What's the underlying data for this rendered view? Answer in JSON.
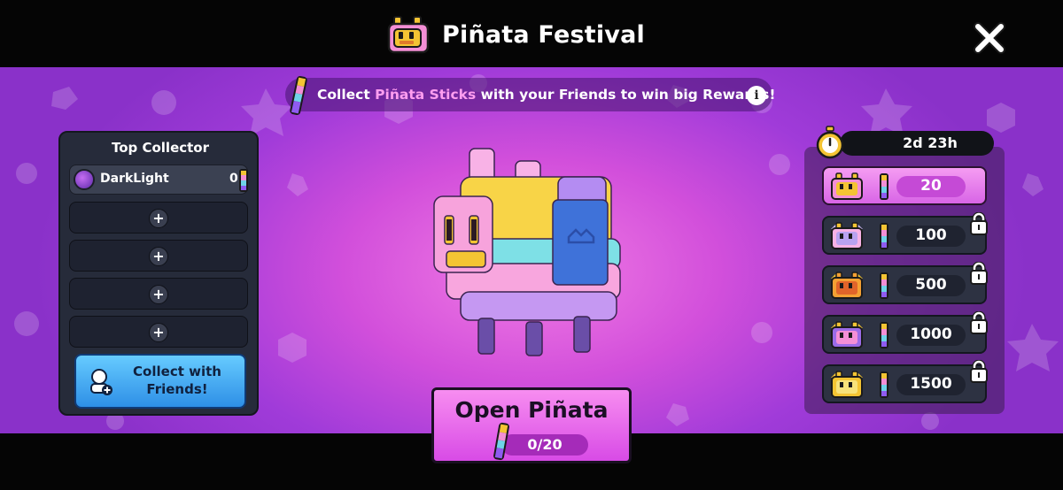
{
  "header": {
    "title": "Piñata Festival",
    "close_label": "close"
  },
  "banner": {
    "text_before": "Collect ",
    "highlight": "Piñata Sticks",
    "text_after": " with your Friends to win big Rewards!",
    "info_label": "i"
  },
  "left_panel": {
    "title": "Top Collector",
    "collector": {
      "name": "DarkLight",
      "count": "0"
    },
    "empty_slots": [
      "+",
      "+",
      "+",
      "+"
    ],
    "collect_button_label": "Collect with Friends!"
  },
  "open_button": {
    "label": "Open Piñata",
    "progress": "0/20",
    "progress_value": 0,
    "progress_max": 20
  },
  "rewards": {
    "timer": "2d 23h",
    "tiers": [
      {
        "value": "20",
        "locked": false,
        "active": true,
        "icon": "pinata-tier-1-icon"
      },
      {
        "value": "100",
        "locked": true,
        "active": false,
        "icon": "pinata-tier-2-icon"
      },
      {
        "value": "500",
        "locked": true,
        "active": false,
        "icon": "pinata-tier-3-icon"
      },
      {
        "value": "1000",
        "locked": true,
        "active": false,
        "icon": "pinata-tier-4-icon"
      },
      {
        "value": "1500",
        "locked": true,
        "active": false,
        "icon": "pinata-tier-5-icon"
      }
    ]
  },
  "colors": {
    "accent_pink": "#f78df0",
    "highlight_text": "#ff9ef0",
    "panel_dark": "#262b3a",
    "button_blue": "#2e8fe6"
  }
}
